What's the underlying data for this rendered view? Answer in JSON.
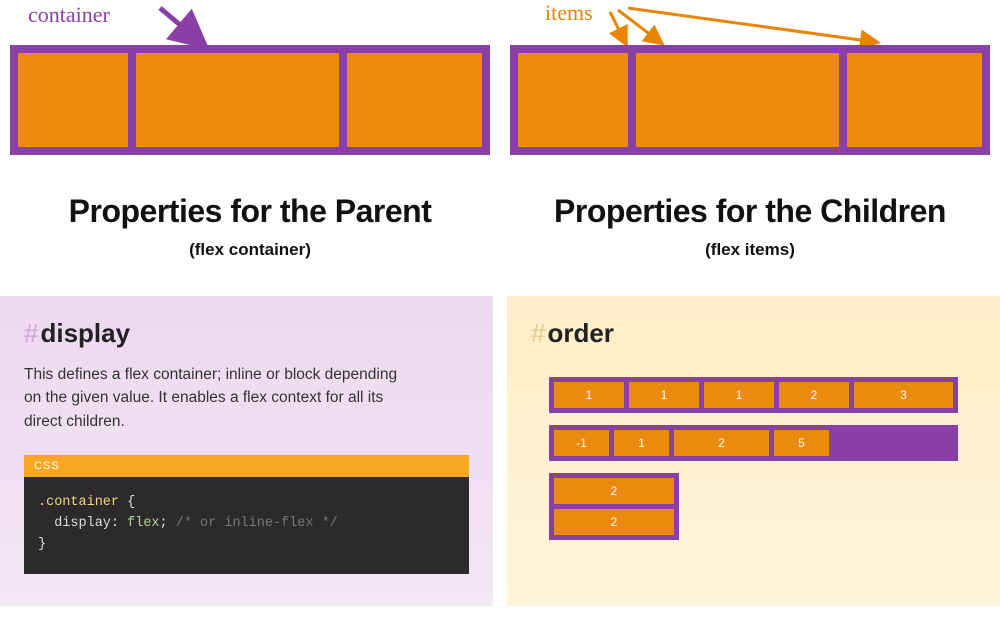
{
  "top": {
    "container_label": "container",
    "items_label": "items"
  },
  "headings": {
    "parent": {
      "title": "Properties for the Parent",
      "sub": "(flex container)"
    },
    "children": {
      "title": "Properties for the Children",
      "sub": "(flex items)"
    }
  },
  "display_panel": {
    "hash": "#",
    "title": "display",
    "desc": "This defines a flex container; inline or block depending on the given value. It enables a flex context for all its direct children.",
    "code_lang": "CSS",
    "code": {
      "selector": ".container",
      "open": " {",
      "prop": "  display",
      "colon": ": ",
      "value": "flex",
      "semi": ";",
      "comment": " /* or inline-flex */",
      "close": "}"
    }
  },
  "order_panel": {
    "hash": "#",
    "title": "order",
    "rows": {
      "r1": [
        "1",
        "1",
        "1",
        "2",
        "3"
      ],
      "r2": [
        "-1",
        "1",
        "2",
        "5"
      ],
      "r3": [
        "2",
        "2"
      ]
    }
  },
  "colors": {
    "purple": "#8a3fa6",
    "orange": "#ed8a0e",
    "panel_purple": "#eed8f0",
    "panel_orange": "#ffeec8",
    "code_bg": "#2d2a2d",
    "code_header": "#f6a623"
  }
}
